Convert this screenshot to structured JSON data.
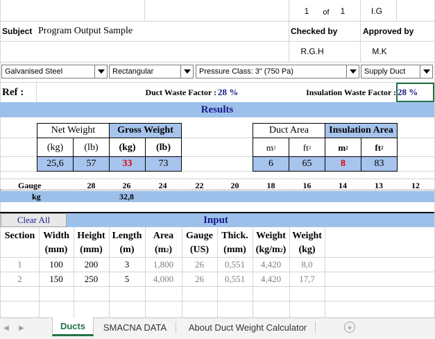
{
  "header": {
    "page_num": "1",
    "of_label": "of",
    "page_total": "1",
    "ig": "I.G",
    "subject_label": "Subject",
    "subject_value": "Program Output Sample",
    "checked_by_label": "Checked by",
    "approved_by_label": "Approved by",
    "checked_by_value": "R.G.H",
    "approved_by_value": "M.K"
  },
  "dropdowns": [
    {
      "value": "Galvanised Steel"
    },
    {
      "value": "Rectangular"
    },
    {
      "value": "Pressure Class: 3\" (750 Pa)"
    },
    {
      "value": "Supply Duct"
    }
  ],
  "ref": {
    "label": "Ref :",
    "duct_waste_label": "Duct Waste Factor :",
    "duct_waste_value": "28 %",
    "insulation_waste_label": "Insulation Waste Factor :",
    "insulation_waste_value": "28 %"
  },
  "results": {
    "title": "Results",
    "net_weight": "Net Weight",
    "gross_weight": "Gross Weight",
    "kg": "(kg)",
    "lb": "(lb)",
    "net_kg": "25,6",
    "net_lb": "57",
    "gross_kg": "33",
    "gross_lb": "73",
    "duct_area": "Duct Area",
    "insulation_area": "Insulation Area",
    "m2": "m",
    "ft2": "ft",
    "sup": "2",
    "duct_m2": "6",
    "duct_ft2": "65",
    "ins_m2": "8",
    "ins_ft2": "83"
  },
  "gauge": {
    "gauge_label": "Gauge",
    "kg_label": "kg",
    "values": [
      "28",
      "26",
      "24",
      "22",
      "20",
      "18",
      "16",
      "14",
      "13",
      "12"
    ],
    "kg_value": "32,8"
  },
  "input": {
    "clear_all": "Clear All",
    "title": "Input",
    "headers": [
      "Section",
      "Width",
      "Height",
      "Length",
      "Area",
      "Gauge",
      "Thick.",
      "Weight",
      "Weight"
    ],
    "units": [
      "",
      "(mm)",
      "(mm)",
      "(m)",
      "(m",
      "(US)",
      "(mm)",
      "(kg/m",
      "(kg)"
    ],
    "rows": [
      [
        "1",
        "100",
        "200",
        "3",
        "1,800",
        "26",
        "0,551",
        "4,420",
        "8,0"
      ],
      [
        "2",
        "150",
        "250",
        "5",
        "4,000",
        "26",
        "0,551",
        "4,420",
        "17,7"
      ]
    ]
  },
  "tabs": {
    "active": "Ducts",
    "tab2": "SMACNA DATA",
    "tab3": "About Duct Weight Calculator",
    "add": "+"
  },
  "colors": {
    "header_blue": "#a6c4ec",
    "band_blue": "#9cc0ea",
    "highlight_red": "#e00000",
    "value_navy": "#1a1a8c",
    "active_tab_green": "#217346"
  }
}
